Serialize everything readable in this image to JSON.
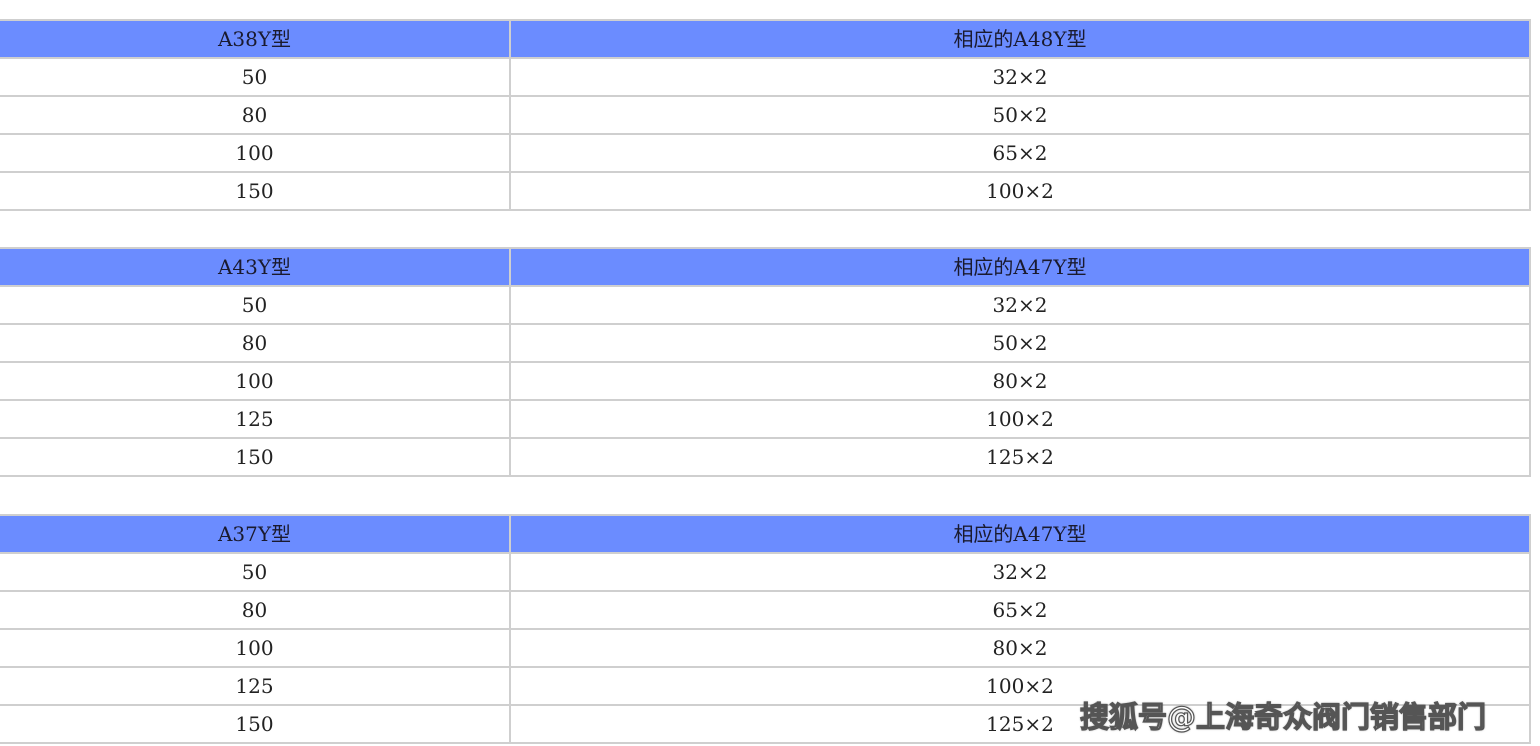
{
  "tables": [
    {
      "headers": [
        "A38Y型",
        "相应的A48Y型"
      ],
      "rows": [
        [
          "50",
          "32×2"
        ],
        [
          "80",
          "50×2"
        ],
        [
          "100",
          "65×2"
        ],
        [
          "150",
          "100×2"
        ]
      ]
    },
    {
      "headers": [
        "A43Y型",
        "相应的A47Y型"
      ],
      "rows": [
        [
          "50",
          "32×2"
        ],
        [
          "80",
          "50×2"
        ],
        [
          "100",
          "80×2"
        ],
        [
          "125",
          "100×2"
        ],
        [
          "150",
          "125×2"
        ]
      ]
    },
    {
      "headers": [
        "A37Y型",
        "相应的A47Y型"
      ],
      "rows": [
        [
          "50",
          "32×2"
        ],
        [
          "80",
          "65×2"
        ],
        [
          "100",
          "80×2"
        ],
        [
          "125",
          "100×2"
        ],
        [
          "150",
          "125×2"
        ]
      ]
    }
  ],
  "watermark": {
    "text": "搜狐号@上海奇众阀门销售部门"
  },
  "colors": {
    "header_background": "#6b8cff",
    "grid_line": "#cfcfcf"
  }
}
